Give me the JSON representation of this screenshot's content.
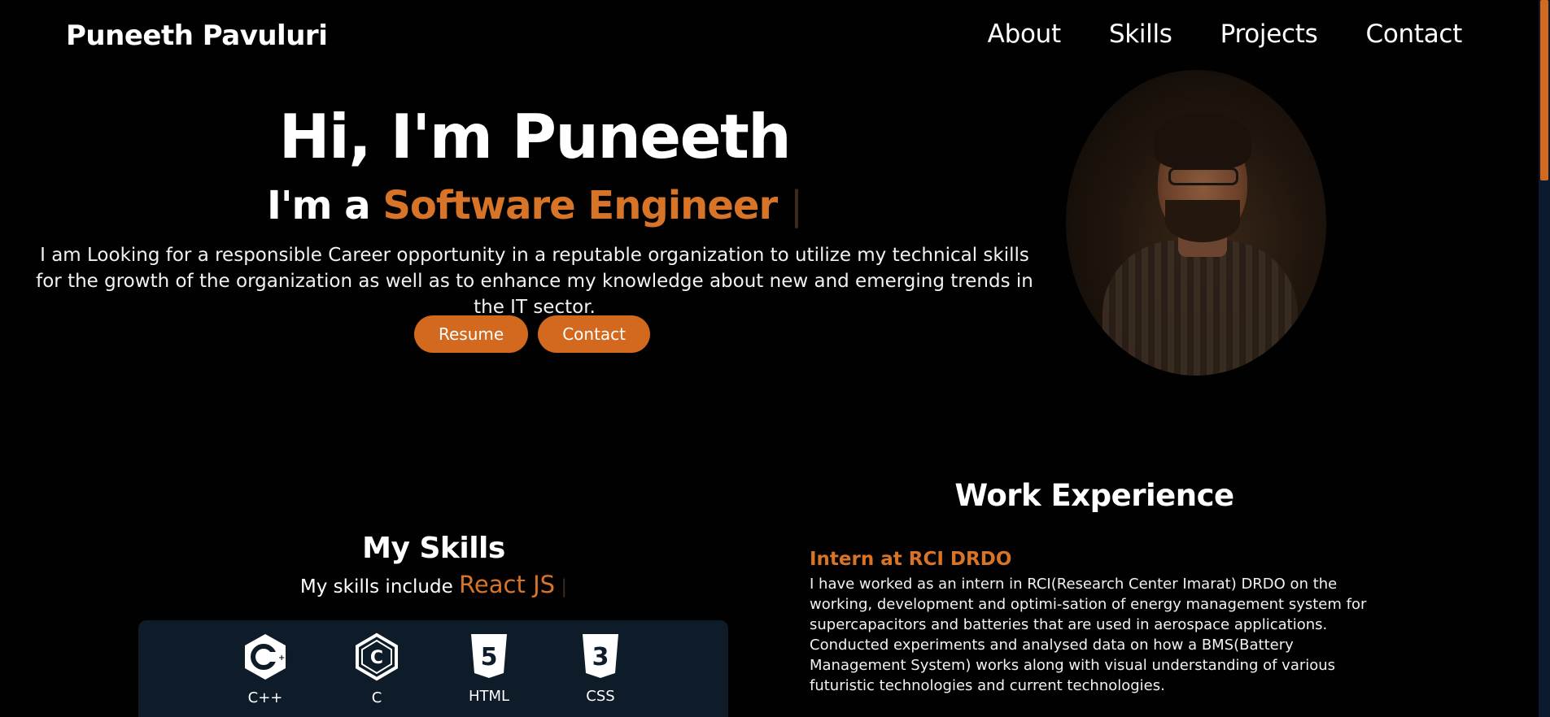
{
  "brand": "Puneeth Pavuluri",
  "nav": {
    "about": "About",
    "skills": "Skills",
    "projects": "Projects",
    "contact": "Contact"
  },
  "hero": {
    "title": "Hi, I'm Puneeth",
    "role_prefix": "I'm a",
    "role": "Software Engineer",
    "cursor": "|",
    "description": "I am Looking for a responsible Career opportunity in a reputable organization to utilize my technical skills for the growth of the organization as well as to enhance my knowledge about new and emerging trends in the IT sector.",
    "resume_button": "Resume",
    "contact_button": "Contact"
  },
  "skills_section": {
    "title": "My Skills",
    "subtitle_prefix": "My skills include",
    "current_skill": "React JS",
    "cursor": "|",
    "items": [
      {
        "label": "C++",
        "icon": "cplusplus-icon"
      },
      {
        "label": "C",
        "icon": "c-icon"
      },
      {
        "label": "HTML",
        "icon": "html5-icon"
      },
      {
        "label": "CSS",
        "icon": "css3-icon"
      }
    ]
  },
  "work": {
    "title": "Work Experience",
    "jobs": [
      {
        "title": "Intern at RCI DRDO",
        "description": "I have worked as an intern in RCI(Research Center Imarat) DRDO on the working, development and optimi-sation of energy management system for supercapacitors and batteries that are used in aerospace applications. Conducted experiments and analysed data on how a BMS(Battery Management System) works along with visual understanding of various futuristic technologies and current technologies."
      }
    ]
  },
  "colors": {
    "background": "#010101",
    "accent": "#d87428",
    "button": "#d2691e",
    "card": "#0e1b29"
  }
}
